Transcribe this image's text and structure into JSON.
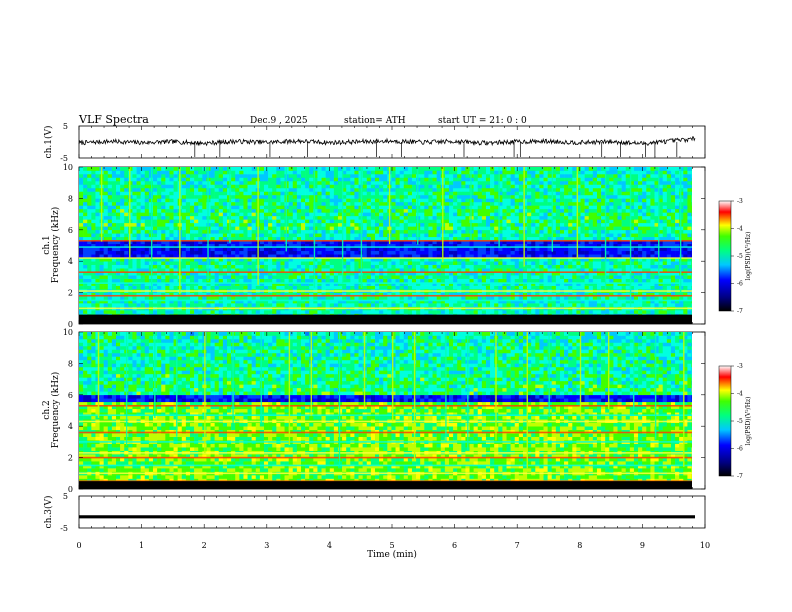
{
  "header": {
    "title": "VLF  Spectra",
    "date": "Dec.9  , 2025",
    "station": "station= ATH",
    "start": "start  UT  =    21: 0  : 0"
  },
  "chart_data": [
    {
      "type": "line",
      "name": "ch1-waveform",
      "ylabel": "ch.1(V)",
      "ylim": [
        -5,
        5
      ],
      "y_ticks": [
        "5",
        "-5"
      ],
      "xlim": [
        0,
        10
      ],
      "x_end": 9.85,
      "baseline": 0,
      "x": [
        0,
        0.5,
        1,
        1.5,
        2,
        2.5,
        3,
        3.5,
        4,
        4.5,
        5,
        5.5,
        6,
        6.5,
        7,
        7.5,
        8,
        8.5,
        9,
        9.5,
        9.85
      ],
      "y": [
        -0.3,
        0.2,
        -0.2,
        0.1,
        -0.4,
        0.2,
        -0.1,
        0.3,
        -0.2,
        0.1,
        0.3,
        -0.1,
        0.2,
        -0.3,
        0.1,
        0.2,
        -0.2,
        0.1,
        -0.5,
        0.4,
        1.0
      ],
      "spike_times": [
        1.85,
        2.25,
        3.05,
        3.65,
        4.75,
        5.15,
        6.15,
        6.95,
        7.05,
        8.35,
        8.65,
        9.05,
        9.2,
        9.55
      ]
    },
    {
      "type": "heatmap",
      "name": "ch1-spectrogram",
      "ylabel": "ch.1\nFrequency (kHz)",
      "ylabel_line1": "ch.1",
      "ylabel_line2": "Frequency (kHz)",
      "xlim": [
        0,
        10
      ],
      "ylim": [
        0,
        10
      ],
      "y_ticks": [
        "0",
        "2",
        "4",
        "6",
        "8",
        "10"
      ],
      "x_end": 9.85,
      "colorbar": {
        "label": "log(PSD)(V²/Hz)",
        "range": [
          -7,
          -3
        ],
        "ticks": [
          "-3",
          "-4",
          "-5",
          "-6",
          "-7"
        ]
      },
      "horizontal_lines_khz": [
        0.5,
        1.0,
        1.5,
        1.8,
        2.1,
        2.6,
        3.3,
        4.2,
        4.9,
        5.3
      ],
      "dark_band_khz": [
        4.2,
        5.3
      ],
      "noise_floor_bottom_khz": 0.6,
      "transient_times_min": [
        0.35,
        0.8,
        1.15,
        1.6,
        2.05,
        2.4,
        2.85,
        3.3,
        3.75,
        4.2,
        4.5,
        4.95,
        5.4,
        5.8,
        6.25,
        6.7,
        7.1,
        7.55,
        7.95,
        8.4,
        8.8,
        9.25,
        9.6
      ]
    },
    {
      "type": "heatmap",
      "name": "ch2-spectrogram",
      "ylabel": "ch.2\nFrequency (kHz)",
      "ylabel_line1": "ch.2",
      "ylabel_line2": "Frequency (kHz)",
      "xlim": [
        0,
        10
      ],
      "ylim": [
        0,
        10
      ],
      "y_ticks": [
        "0",
        "2",
        "4",
        "6",
        "8",
        "10"
      ],
      "x_end": 9.85,
      "colorbar": {
        "label": "log(PSD)(V²/Hz)",
        "range": [
          -7,
          -3
        ],
        "ticks": [
          "-3",
          "-4",
          "-5",
          "-6",
          "-7"
        ]
      },
      "horizontal_lines_khz": [
        0.5,
        1.0,
        1.5,
        2.0,
        2.3,
        3.0,
        3.6,
        4.3,
        4.7,
        5.3
      ],
      "dark_band_khz": [
        5.5,
        7.0
      ],
      "noise_floor_bottom_khz": 0.5,
      "transient_times_min": [
        0.3,
        0.75,
        1.2,
        1.55,
        2.0,
        2.45,
        2.9,
        3.35,
        3.7,
        4.15,
        4.55,
        5.0,
        5.35,
        5.85,
        6.2,
        6.65,
        7.15,
        7.5,
        8.0,
        8.45,
        8.85,
        9.2,
        9.65
      ]
    },
    {
      "type": "line",
      "name": "ch3-waveform",
      "ylabel": "ch.3(V)",
      "ylim": [
        -5,
        5
      ],
      "y_ticks": [
        "5",
        "-5"
      ],
      "xlim": [
        0,
        10
      ],
      "x_end": 9.85,
      "x": [
        0,
        9.85
      ],
      "y": [
        -1.5,
        -1.5
      ],
      "xlabel": "Time  (min)",
      "x_ticks": [
        "0",
        "1",
        "2",
        "3",
        "4",
        "5",
        "6",
        "7",
        "8",
        "9",
        "10"
      ]
    }
  ]
}
